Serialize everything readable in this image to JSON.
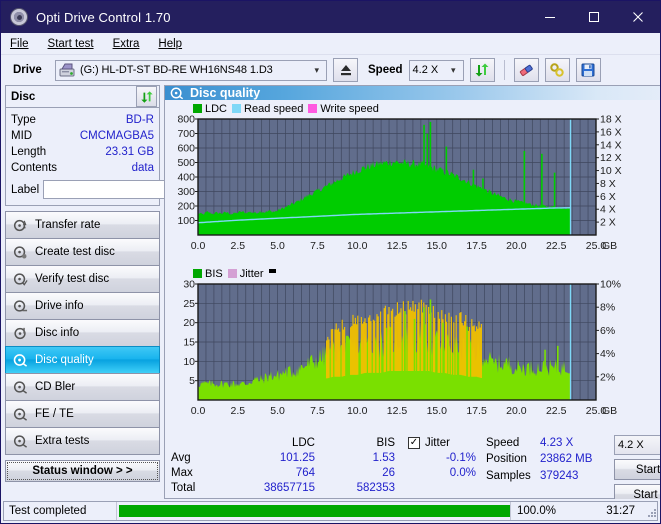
{
  "window": {
    "title": "Opti Drive Control 1.70",
    "minimize": "minimize-icon",
    "maximize": "maximize-icon",
    "close": "close-icon"
  },
  "menu": {
    "items": [
      {
        "label": "File",
        "accel": "F"
      },
      {
        "label": "Start test",
        "accel": "S"
      },
      {
        "label": "Extra",
        "accel": "x"
      },
      {
        "label": "Help",
        "accel": "H"
      }
    ]
  },
  "toolbar": {
    "drive_label": "Drive",
    "drive_value": "(G:)  HL-DT-ST BD-RE  WH16NS48 1.D3",
    "eject_icon": "eject-icon",
    "speed_label": "Speed",
    "speed_value": "4.2 X",
    "refresh_icon": "refresh-icon",
    "erase_icon": "eraser-icon",
    "tools_icon": "tools-icon",
    "save_icon": "save-icon"
  },
  "disc_panel": {
    "title": "Disc",
    "refresh_icon": "refresh-icon",
    "rows": [
      {
        "key": "Type",
        "value": "BD-R"
      },
      {
        "key": "MID",
        "value": "CMCMAGBA5"
      },
      {
        "key": "Length",
        "value": "23.31 GB"
      },
      {
        "key": "Contents",
        "value": "data"
      }
    ],
    "label_key": "Label",
    "label_value": "",
    "label_placeholder": "",
    "disc_icon": "disc-icon"
  },
  "nav": {
    "items": [
      {
        "label": "Transfer rate",
        "icon": "disc-transfer-icon",
        "active": false
      },
      {
        "label": "Create test disc",
        "icon": "disc-create-icon",
        "active": false
      },
      {
        "label": "Verify test disc",
        "icon": "disc-verify-icon",
        "active": false
      },
      {
        "label": "Drive info",
        "icon": "drive-info-icon",
        "active": false
      },
      {
        "label": "Disc info",
        "icon": "disc-info-icon",
        "active": false
      },
      {
        "label": "Disc quality",
        "icon": "disc-quality-icon",
        "active": true
      },
      {
        "label": "CD Bler",
        "icon": "cd-bler-icon",
        "active": false
      },
      {
        "label": "FE / TE",
        "icon": "fe-te-icon",
        "active": false
      },
      {
        "label": "Extra tests",
        "icon": "extra-tests-icon",
        "active": false
      }
    ],
    "status_window": "Status window > >"
  },
  "content": {
    "header": "Disc quality",
    "header_icon": "disc-quality-icon"
  },
  "chart_data": [
    {
      "type": "area",
      "title": "LDC / Read speed",
      "legend": [
        {
          "label": "LDC",
          "color": "#00a800"
        },
        {
          "label": "Read speed",
          "color": "#7fd8f7"
        },
        {
          "label": "Write speed",
          "color": "#ff5ae0"
        }
      ],
      "legend_position": "top-left",
      "grid": true,
      "plot_bg": "#616d8c",
      "xlabel": "GB",
      "xticks": [
        "0.0",
        "2.5",
        "5.0",
        "7.5",
        "10.0",
        "12.5",
        "15.0",
        "17.5",
        "20.0",
        "22.5",
        "25.0"
      ],
      "xlim": [
        0,
        25
      ],
      "ylabel_left": "LDC",
      "yticks_left": [
        100,
        200,
        300,
        400,
        500,
        600,
        700,
        800
      ],
      "ylim_left": [
        0,
        800
      ],
      "ylabel_right": "X",
      "yticks_right": [
        "2 X",
        "4 X",
        "6 X",
        "8 X",
        "10 X",
        "12 X",
        "14 X",
        "16 X",
        "18 X"
      ],
      "ylim_right": [
        0,
        18
      ],
      "data_end_gb": 23.4,
      "series": [
        {
          "name": "LDC",
          "color": "#00cc00",
          "x": [
            0.0,
            0.3,
            0.6,
            0.9,
            1.2,
            1.5,
            1.8,
            2.1,
            2.4,
            2.7,
            3.0,
            3.3,
            3.6,
            3.9,
            4.2,
            4.5,
            4.8,
            5.1,
            5.4,
            5.7,
            6.0,
            6.3,
            6.6,
            6.9,
            7.2,
            7.5,
            7.8,
            8.1,
            8.4,
            8.7,
            9.0,
            9.3,
            9.6,
            9.9,
            10.2,
            10.5,
            10.8,
            11.1,
            11.4,
            11.7,
            12.0,
            12.3,
            12.6,
            12.9,
            13.2,
            13.5,
            13.8,
            14.1,
            14.4,
            14.7,
            15.0,
            15.3,
            15.6,
            15.9,
            16.2,
            16.5,
            16.8,
            17.1,
            17.4,
            17.7,
            18.0,
            18.3,
            18.6,
            18.9,
            19.2,
            19.5,
            19.8,
            20.1,
            20.4,
            20.7,
            21.0,
            21.3,
            21.6,
            21.9,
            22.2,
            22.5,
            22.8,
            23.1,
            23.4
          ],
          "values": [
            150,
            140,
            158,
            145,
            152,
            148,
            155,
            143,
            150,
            160,
            152,
            158,
            150,
            162,
            155,
            165,
            158,
            172,
            185,
            200,
            215,
            230,
            250,
            268,
            285,
            300,
            318,
            335,
            352,
            370,
            388,
            400,
            420,
            435,
            448,
            460,
            470,
            480,
            488,
            492,
            496,
            500,
            495,
            490,
            488,
            486,
            484,
            480,
            470,
            460,
            450,
            440,
            428,
            415,
            400,
            388,
            372,
            355,
            340,
            325,
            310,
            295,
            280,
            268,
            255,
            245,
            235,
            228,
            220,
            215,
            208,
            202,
            198,
            195,
            192,
            190,
            188,
            186,
            185
          ]
        },
        {
          "name": "Read speed",
          "color": "#7fd8f7",
          "x": [
            0.0,
            2.5,
            5.0,
            7.5,
            10.0,
            12.5,
            15.0,
            17.5,
            20.0,
            22.5,
            23.4
          ],
          "values": [
            1.9,
            2.3,
            2.6,
            2.9,
            3.2,
            3.4,
            3.6,
            3.8,
            4.0,
            4.2,
            4.23
          ]
        }
      ],
      "spikes": [
        {
          "x": 14.2,
          "y": 760
        },
        {
          "x": 14.4,
          "y": 700
        },
        {
          "x": 14.6,
          "y": 780
        },
        {
          "x": 15.6,
          "y": 610
        },
        {
          "x": 17.3,
          "y": 450
        },
        {
          "x": 17.9,
          "y": 390
        },
        {
          "x": 20.5,
          "y": 580
        },
        {
          "x": 21.6,
          "y": 560
        },
        {
          "x": 22.4,
          "y": 430
        }
      ]
    },
    {
      "type": "area",
      "title": "BIS / Jitter",
      "legend": [
        {
          "label": "BIS",
          "color": "#00a800"
        },
        {
          "label": "Jitter",
          "color": "#d4a0d4"
        }
      ],
      "legend_position": "top-left",
      "grid": true,
      "plot_bg": "#616d8c",
      "xlabel": "GB",
      "xticks": [
        "0.0",
        "2.5",
        "5.0",
        "7.5",
        "10.0",
        "12.5",
        "15.0",
        "17.5",
        "20.0",
        "22.5",
        "25.0"
      ],
      "xlim": [
        0,
        25
      ],
      "ylabel_left": "BIS",
      "yticks_left": [
        5,
        10,
        15,
        20,
        25,
        30
      ],
      "ylim_left": [
        0,
        30
      ],
      "ylabel_right": "%",
      "yticks_right": [
        "2%",
        "4%",
        "6%",
        "8%",
        "10%"
      ],
      "ylim_right": [
        0,
        10
      ],
      "data_end_gb": 23.4,
      "series": [
        {
          "name": "BIS",
          "color": "#7ae000",
          "x": [
            0.0,
            0.5,
            1.0,
            1.5,
            2.0,
            2.5,
            3.0,
            3.5,
            4.0,
            4.5,
            5.0,
            5.5,
            6.0,
            6.5,
            7.0,
            7.5,
            8.0,
            8.5,
            9.0,
            9.5,
            10.0,
            10.5,
            11.0,
            11.5,
            12.0,
            12.5,
            13.0,
            13.5,
            14.0,
            14.5,
            15.0,
            15.5,
            16.0,
            16.5,
            17.0,
            17.5,
            18.0,
            18.5,
            19.0,
            19.5,
            20.0,
            20.5,
            21.0,
            21.5,
            22.0,
            22.5,
            23.0,
            23.4
          ],
          "values": [
            4,
            4,
            4,
            4,
            4,
            4,
            4,
            5,
            5,
            6,
            6,
            7,
            7,
            8,
            9,
            10,
            11,
            12,
            12,
            13,
            13,
            14,
            14,
            14,
            15,
            15,
            15,
            15,
            15,
            15,
            14,
            14,
            13,
            13,
            12,
            12,
            11,
            9,
            9,
            9,
            8,
            8,
            8,
            8,
            8,
            8,
            8,
            8
          ]
        },
        {
          "name": "Jitter",
          "color": "#f0c000",
          "x": [
            8.0,
            9.0,
            10.0,
            11.0,
            12.0,
            13.0,
            14.0,
            15.0,
            16.0,
            17.0,
            17.8
          ],
          "values": [
            3.5,
            4.0,
            4.3,
            4.6,
            4.9,
            5.3,
            5.6,
            5.2,
            4.8,
            4.6,
            4.0
          ]
        }
      ],
      "spikes": [
        {
          "x": 13.0,
          "y": 23
        },
        {
          "x": 13.6,
          "y": 21
        },
        {
          "x": 14.2,
          "y": 24
        },
        {
          "x": 14.6,
          "y": 26
        },
        {
          "x": 15.4,
          "y": 20
        },
        {
          "x": 16.9,
          "y": 19
        },
        {
          "x": 21.8,
          "y": 13
        },
        {
          "x": 22.6,
          "y": 14
        }
      ]
    }
  ],
  "stats": {
    "col_headers": [
      "LDC",
      "BIS"
    ],
    "rows": [
      {
        "label": "Avg",
        "ldc": "101.25",
        "bis": "1.53"
      },
      {
        "label": "Max",
        "ldc": "764",
        "bis": "26"
      },
      {
        "label": "Total",
        "ldc": "38657715",
        "bis": "582353"
      }
    ],
    "jitter": {
      "checked": true,
      "check_glyph": "✓",
      "label": "Jitter",
      "avg": "-0.1%",
      "max": "0.0%"
    },
    "speed_label": "Speed",
    "speed_value": "4.23 X",
    "position_label": "Position",
    "position_value": "23862 MB",
    "samples_label": "Samples",
    "samples_value": "379243",
    "speed_select": "4.2 X",
    "start_full": "Start full",
    "start_part": "Start part"
  },
  "statusbar": {
    "message": "Test completed",
    "progress_percent": 100.0,
    "progress_text": "100.0%",
    "elapsed": "31:27"
  },
  "colors": {
    "titlebar": "#241f5e",
    "accent_blue": "#2222cc",
    "plot_bg": "#616d8c",
    "ldc_green": "#00cc00",
    "bis_green": "#7ae000",
    "jitter_yellow": "#f0c000",
    "read_speed_cyan": "#7fd8f7",
    "progress_green": "#00a800"
  }
}
